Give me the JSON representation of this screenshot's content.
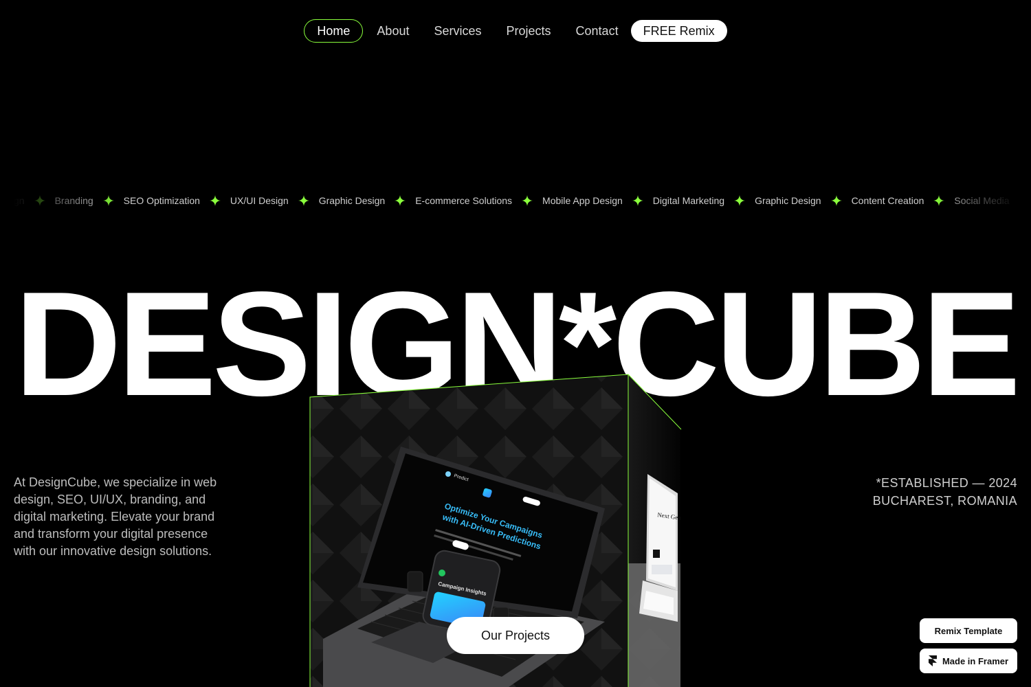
{
  "nav": {
    "items": [
      {
        "label": "Home"
      },
      {
        "label": "About"
      },
      {
        "label": "Services"
      },
      {
        "label": "Projects"
      },
      {
        "label": "Contact"
      }
    ],
    "cta": "FREE Remix"
  },
  "marquee": {
    "items": [
      "Design",
      "Branding",
      "SEO Optimization",
      "UX/UI Design",
      "Graphic Design",
      "E-commerce Solutions",
      "Mobile App Design",
      "Digital Marketing",
      "Graphic Design",
      "Content Creation",
      "Social Media"
    ]
  },
  "hero": {
    "title": "DESIGN*CUBE"
  },
  "intro": "At DesignCube, we specialize in web design, SEO, UI/UX, branding, and digital marketing. Elevate your brand and transform your digital presence with our innovative design solutions.",
  "established": {
    "line1": "*ESTABLISHED — 2024",
    "line2": "BUCHAREST, ROMANIA"
  },
  "laptop_screen": {
    "brand": "Predict",
    "headline_1": "Optimize Your Campaigns",
    "headline_2": "with AI-Driven Predictions",
    "phone_title": "Campaign Insights"
  },
  "side_screen": {
    "headline": "Next Gen Products"
  },
  "cta_button": "Our Projects",
  "badges": {
    "remix": "Remix Template",
    "framer": "Made in Framer"
  },
  "colors": {
    "accent": "#8aff3c",
    "background": "#000000"
  }
}
